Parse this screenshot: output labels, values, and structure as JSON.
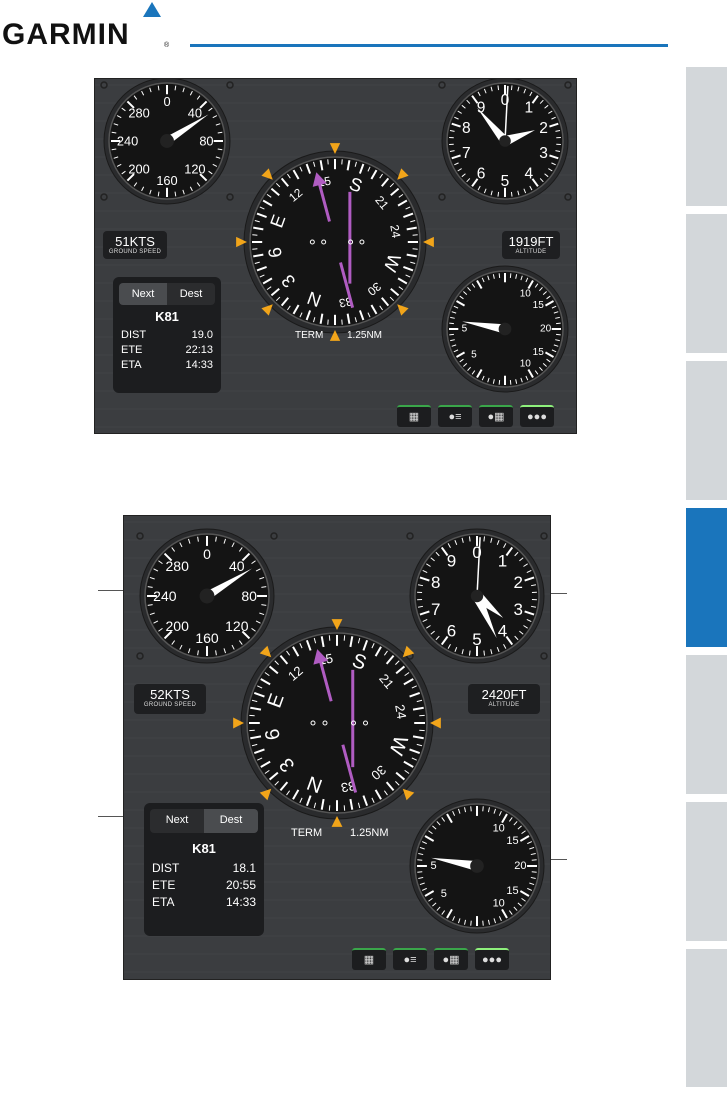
{
  "brand": {
    "name": "GARMIN",
    "reg_mark": "®",
    "accent_color": "#1a75bc"
  },
  "side_tabs": {
    "count": 7,
    "active_index": 3
  },
  "panels": [
    {
      "airspeed": {
        "labels": [
          "0",
          "40",
          "80",
          "120",
          "160",
          "200",
          "240",
          "280"
        ],
        "needle_value": 51
      },
      "ground_speed": {
        "value": "51KTS",
        "label": "GROUND SPEED"
      },
      "altitude": {
        "value": "1919FT",
        "label": "ALTITUDE"
      },
      "altimeter": {
        "labels": [
          "0",
          "1",
          "2",
          "3",
          "4",
          "5",
          "6",
          "7",
          "8",
          "9"
        ]
      },
      "hsi": {
        "labels": [
          "N",
          "3",
          "6",
          "E",
          "12",
          "15",
          "S",
          "21",
          "24",
          "W",
          "30",
          "33"
        ],
        "course_color": "#b05cc2"
      },
      "scale_label": "TERM",
      "scale_value": "1.25NM",
      "vsi": {
        "labels": [
          "10",
          "15",
          "20",
          "15",
          "10",
          "5",
          "5"
        ]
      },
      "waypoint": {
        "tab_next": "Next",
        "tab_dest": "Dest",
        "id": "K81",
        "rows": [
          {
            "k": "DIST",
            "v": "19.0"
          },
          {
            "k": "ETE",
            "v": "22:13"
          },
          {
            "k": "ETA",
            "v": "14:33"
          }
        ]
      },
      "buttons": [
        {
          "icon": "grid-icon",
          "glyph": "▦"
        },
        {
          "icon": "gauge-list-icon",
          "glyph": "●≡"
        },
        {
          "icon": "gauge-grid-icon",
          "glyph": "●▦"
        },
        {
          "icon": "gauges-icon",
          "glyph": "●●●"
        }
      ]
    },
    {
      "airspeed": {
        "labels": [
          "0",
          "40",
          "80",
          "120",
          "160",
          "200",
          "240",
          "280"
        ],
        "needle_value": 52
      },
      "ground_speed": {
        "value": "52KTS",
        "label": "GROUND SPEED"
      },
      "altitude": {
        "value": "2420FT",
        "label": "ALTITUDE"
      },
      "altimeter": {
        "labels": [
          "0",
          "1",
          "2",
          "3",
          "4",
          "5",
          "6",
          "7",
          "8",
          "9"
        ]
      },
      "hsi": {
        "labels": [
          "N",
          "3",
          "6",
          "E",
          "12",
          "15",
          "S",
          "21",
          "24",
          "W",
          "30",
          "33"
        ],
        "course_color": "#b05cc2"
      },
      "scale_label": "TERM",
      "scale_value": "1.25NM",
      "vsi": {
        "labels": [
          "10",
          "15",
          "20",
          "15",
          "10",
          "5",
          "5"
        ]
      },
      "waypoint": {
        "tab_next": "Next",
        "tab_dest": "Dest",
        "id": "K81",
        "rows": [
          {
            "k": "DIST",
            "v": "18.1"
          },
          {
            "k": "ETE",
            "v": "20:55"
          },
          {
            "k": "ETA",
            "v": "14:33"
          }
        ]
      },
      "buttons": [
        {
          "icon": "grid-icon",
          "glyph": "▦"
        },
        {
          "icon": "gauge-list-icon",
          "glyph": "●≡"
        },
        {
          "icon": "gauge-grid-icon",
          "glyph": "●▦"
        },
        {
          "icon": "gauges-icon",
          "glyph": "●●●"
        }
      ]
    }
  ]
}
